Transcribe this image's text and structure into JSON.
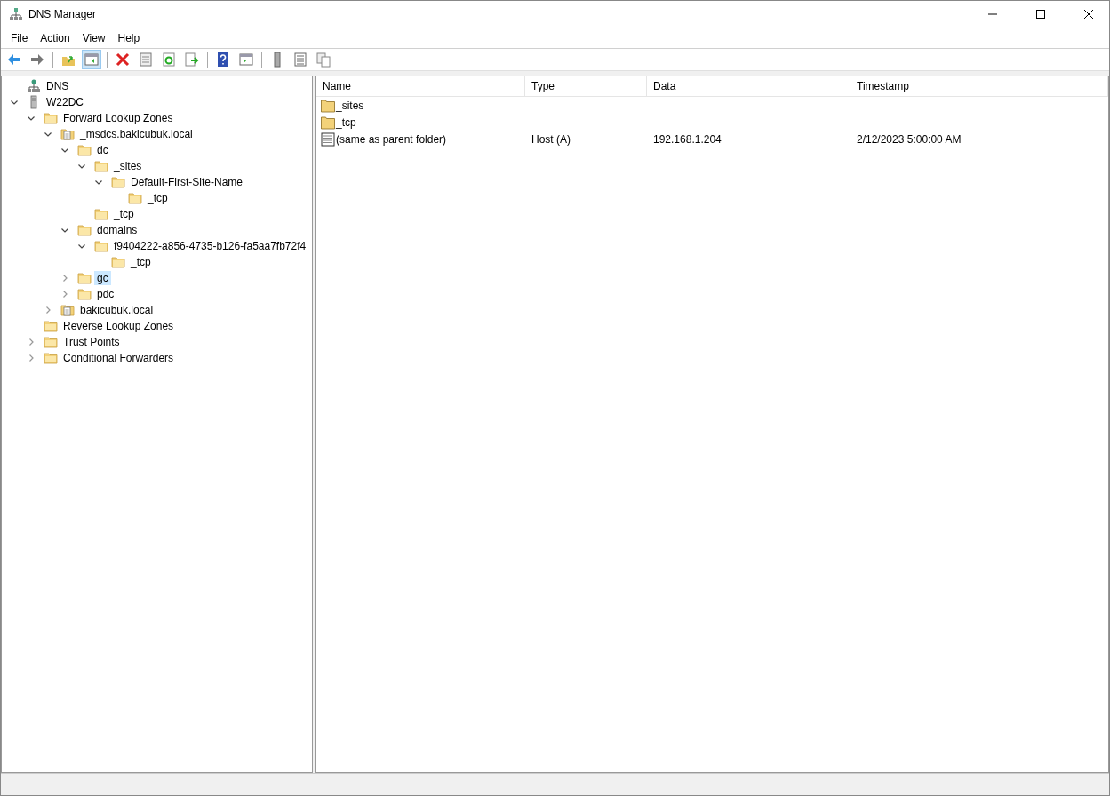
{
  "window": {
    "title": "DNS Manager"
  },
  "menu": [
    "File",
    "Action",
    "View",
    "Help"
  ],
  "toolbar": [
    {
      "kind": "back",
      "pressed": false
    },
    {
      "kind": "forward",
      "pressed": false
    },
    {
      "kind": "sep"
    },
    {
      "kind": "up",
      "pressed": false
    },
    {
      "kind": "tree",
      "pressed": true
    },
    {
      "kind": "sep"
    },
    {
      "kind": "delete",
      "pressed": false
    },
    {
      "kind": "properties",
      "pressed": false
    },
    {
      "kind": "refresh",
      "pressed": false
    },
    {
      "kind": "export",
      "pressed": false
    },
    {
      "kind": "sep"
    },
    {
      "kind": "help",
      "pressed": false
    },
    {
      "kind": "window",
      "pressed": false
    },
    {
      "kind": "sep"
    },
    {
      "kind": "server",
      "pressed": false
    },
    {
      "kind": "list",
      "pressed": false
    },
    {
      "kind": "copy",
      "pressed": false
    }
  ],
  "tree": [
    {
      "label": "DNS",
      "kind": "dns",
      "selected": false,
      "children": [
        {
          "label": "W22DC",
          "kind": "server",
          "expanded": true,
          "selected": false,
          "children": [
            {
              "label": "Forward Lookup Zones",
              "kind": "folder",
              "expanded": true,
              "selected": false,
              "children": [
                {
                  "label": "_msdcs.bakicubuk.local",
                  "kind": "zone",
                  "expanded": true,
                  "selected": false,
                  "children": [
                    {
                      "label": "dc",
                      "kind": "folder",
                      "expanded": true,
                      "selected": false,
                      "children": [
                        {
                          "label": "_sites",
                          "kind": "folder",
                          "expanded": true,
                          "selected": false,
                          "children": [
                            {
                              "label": "Default-First-Site-Name",
                              "kind": "folder",
                              "expanded": true,
                              "selected": false,
                              "children": [
                                {
                                  "label": "_tcp",
                                  "kind": "folder",
                                  "selected": false
                                }
                              ]
                            }
                          ]
                        },
                        {
                          "label": "_tcp",
                          "kind": "folder",
                          "selected": false
                        }
                      ]
                    },
                    {
                      "label": "domains",
                      "kind": "folder",
                      "expanded": true,
                      "selected": false,
                      "children": [
                        {
                          "label": "f9404222-a856-4735-b126-fa5aa7fb72f4",
                          "kind": "folder",
                          "expanded": true,
                          "selected": false,
                          "children": [
                            {
                              "label": "_tcp",
                              "kind": "folder",
                              "selected": false
                            }
                          ]
                        }
                      ]
                    },
                    {
                      "label": "gc",
                      "kind": "folder",
                      "expanded": false,
                      "selected": true
                    },
                    {
                      "label": "pdc",
                      "kind": "folder",
                      "expanded": false,
                      "selected": false
                    }
                  ]
                },
                {
                  "label": "bakicubuk.local",
                  "kind": "zone",
                  "expanded": false,
                  "selected": false
                }
              ]
            },
            {
              "label": "Reverse Lookup Zones",
              "kind": "folder",
              "selected": false
            },
            {
              "label": "Trust Points",
              "kind": "folder",
              "expanded": false,
              "selected": false
            },
            {
              "label": "Conditional Forwarders",
              "kind": "folder",
              "expanded": false,
              "selected": false
            }
          ]
        }
      ]
    }
  ],
  "list": {
    "columns": [
      "Name",
      "Type",
      "Data",
      "Timestamp"
    ],
    "rows": [
      {
        "kind": "folder",
        "name": "_sites"
      },
      {
        "kind": "folder",
        "name": "_tcp"
      },
      {
        "kind": "record",
        "name": "(same as parent folder)",
        "type": "Host (A)",
        "data": "192.168.1.204",
        "timestamp": "2/12/2023 5:00:00 AM"
      }
    ]
  }
}
